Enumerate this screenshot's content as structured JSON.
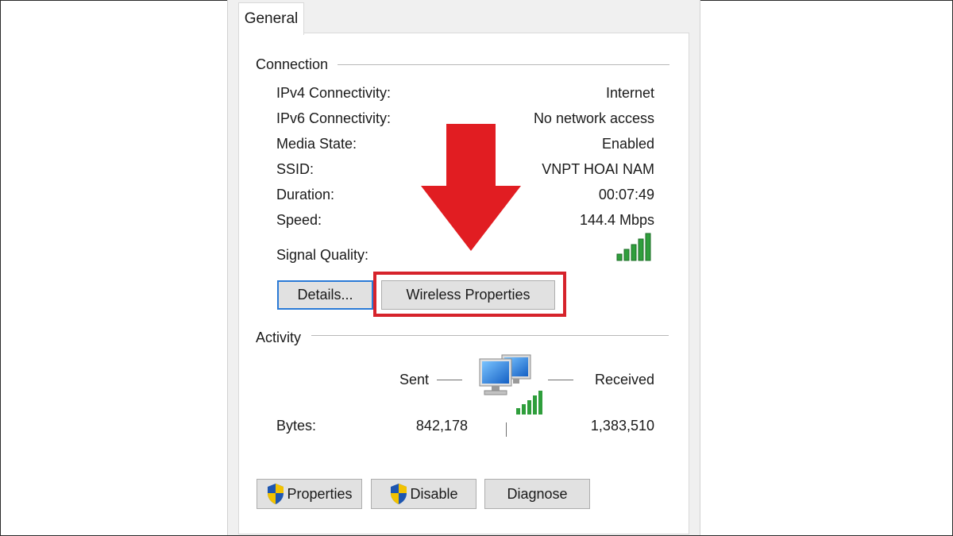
{
  "tabs": {
    "general": "General"
  },
  "connection": {
    "title": "Connection",
    "rows": [
      {
        "label": "IPv4 Connectivity:",
        "value": "Internet"
      },
      {
        "label": "IPv6 Connectivity:",
        "value": "No network access"
      },
      {
        "label": "Media State:",
        "value": "Enabled"
      },
      {
        "label": "SSID:",
        "value": "VNPT HOAI NAM"
      },
      {
        "label": "Duration:",
        "value": "00:07:49"
      },
      {
        "label": "Speed:",
        "value": "144.4 Mbps"
      }
    ],
    "signal_label": "Signal Quality:",
    "signal_bars": 5,
    "signal_icon": "signal-bars-icon"
  },
  "buttons": {
    "details": "Details...",
    "wireless_properties": "Wireless Properties",
    "properties": "Properties",
    "disable": "Disable",
    "diagnose": "Diagnose"
  },
  "activity": {
    "title": "Activity",
    "sent_label": "Sent",
    "received_label": "Received",
    "bytes_label": "Bytes:",
    "bytes_sent": "842,178",
    "bytes_received": "1,383,510",
    "icon": "network-computers-icon"
  },
  "colors": {
    "highlight": "#d6232b",
    "arrow": "#e11d22",
    "signal": "#2f9e3c",
    "focus": "#2a7ad6"
  }
}
